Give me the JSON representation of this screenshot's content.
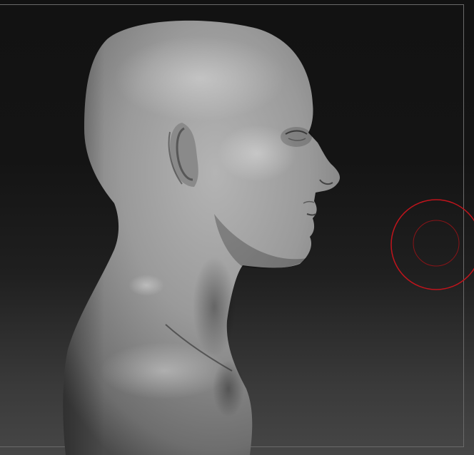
{
  "viewport": {
    "model": "sculpted-head-bust",
    "view": "side-profile",
    "material_color": "#9a9a9a",
    "background_top": "#121212",
    "background_bottom": "#464646",
    "frame_color": "#6a6a6a"
  },
  "brush_cursor": {
    "outer_ring_color": "#c0141c",
    "inner_ring_color": "#8a1418"
  }
}
